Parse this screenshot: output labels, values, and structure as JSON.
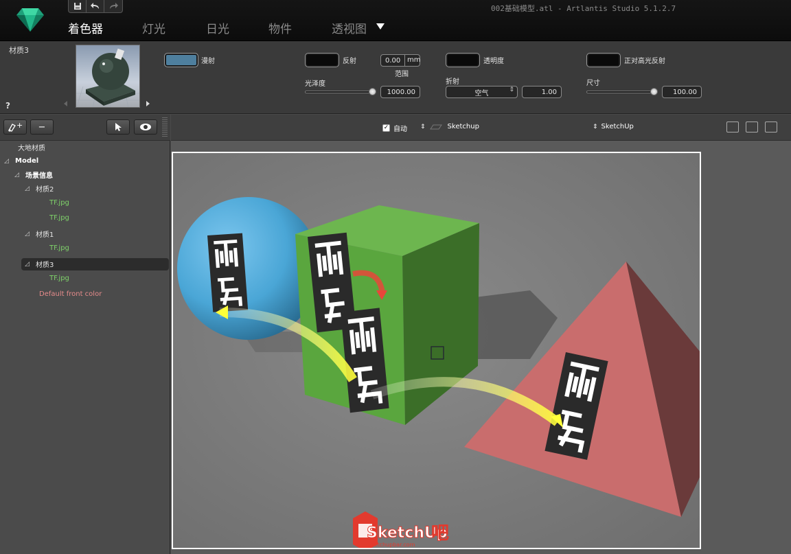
{
  "app": {
    "window_title": "002基础模型.atl - Artlantis Studio 5.1.2.7",
    "quick_access": {
      "save_icon": "save-icon",
      "undo_icon": "undo-icon",
      "redo_icon": "redo-icon"
    },
    "tabs": [
      {
        "label": "着色器",
        "active": true
      },
      {
        "label": "灯光",
        "active": false
      },
      {
        "label": "日光",
        "active": false
      },
      {
        "label": "物件",
        "active": false
      },
      {
        "label": "透视图",
        "active": false
      }
    ]
  },
  "material": {
    "name": "材质3",
    "help": "?",
    "diffuse_label": "漫射",
    "diffuse_color": "#4e7f9e",
    "reflection_label": "反射",
    "range_value": "0.00",
    "range_unit": "mm",
    "range_label": "范围",
    "gloss_label": "光泽度",
    "gloss_value": "1000.00",
    "transparency_label": "透明度",
    "refraction_label": "折射",
    "refraction_medium": "空气",
    "refraction_value": "1.00",
    "specular_label": "正对高光反射",
    "size_label": "尺寸",
    "size_value": "100.00"
  },
  "tree": {
    "items": [
      {
        "label": "大地材质",
        "style": "normal"
      },
      {
        "label": "Model",
        "style": "bold"
      },
      {
        "label": "场景信息",
        "style": "bold"
      },
      {
        "label": "材质2",
        "style": "normal"
      },
      {
        "label": "TF.jpg",
        "style": "green"
      },
      {
        "label": "TF.jpg",
        "style": "green"
      },
      {
        "label": "材质1",
        "style": "normal"
      },
      {
        "label": "TF.jpg",
        "style": "green"
      },
      {
        "label": "材质3",
        "style": "normal",
        "selected": true
      },
      {
        "label": "TF.jpg",
        "style": "green"
      },
      {
        "label": "Default front color",
        "style": "pink"
      }
    ]
  },
  "viewport_bar": {
    "auto_label": "自动",
    "auto_checked": true,
    "sketchup_left": "Sketchup",
    "sketchup_right": "SketchUp"
  },
  "watermark": {
    "brand": "SketchUp",
    "suffix": "吧",
    "url": "sketchupbar.com"
  },
  "colors": {
    "sphere": "#4aa6d6",
    "cube": "#6db64f",
    "pyramid": "#c96d6d",
    "arrow": "#ffff3a",
    "accent_arrow": "#e8463a"
  }
}
